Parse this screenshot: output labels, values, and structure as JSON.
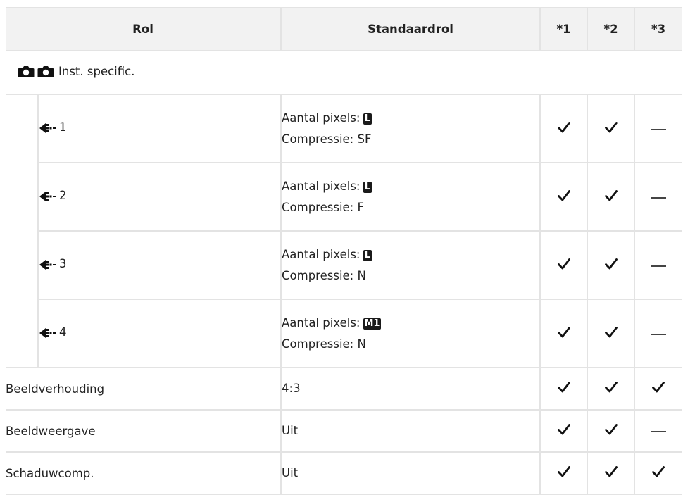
{
  "table": {
    "headers": {
      "role": "Rol",
      "default_role": "Standaardrol",
      "flag1": "*1",
      "flag2": "*2",
      "flag3": "*3"
    },
    "section": {
      "label": "Inst. specific."
    },
    "sub_rows": [
      {
        "number": "1",
        "pixel_label": "Aantal pixels:",
        "pixel_badge": "L",
        "compression": "Compressie: SF",
        "flags": [
          "check",
          "check",
          "dash"
        ]
      },
      {
        "number": "2",
        "pixel_label": "Aantal pixels:",
        "pixel_badge": "L",
        "compression": "Compressie: F",
        "flags": [
          "check",
          "check",
          "dash"
        ]
      },
      {
        "number": "3",
        "pixel_label": "Aantal pixels:",
        "pixel_badge": "L",
        "compression": "Compressie: N",
        "flags": [
          "check",
          "check",
          "dash"
        ]
      },
      {
        "number": "4",
        "pixel_label": "Aantal pixels:",
        "pixel_badge": "M1",
        "compression": "Compressie: N",
        "flags": [
          "check",
          "check",
          "dash"
        ]
      }
    ],
    "rows": [
      {
        "name": "Beeldverhouding",
        "default": "4:3",
        "flags": [
          "check",
          "check",
          "check"
        ]
      },
      {
        "name": "Beeldweergave",
        "default": "Uit",
        "flags": [
          "check",
          "check",
          "dash"
        ]
      },
      {
        "name": "Schaduwcomp.",
        "default": "Uit",
        "flags": [
          "check",
          "check",
          "check"
        ]
      }
    ]
  },
  "colors": {
    "header_bg": "#f2f2f2",
    "border": "#e3e3e3",
    "text": "#222222"
  }
}
